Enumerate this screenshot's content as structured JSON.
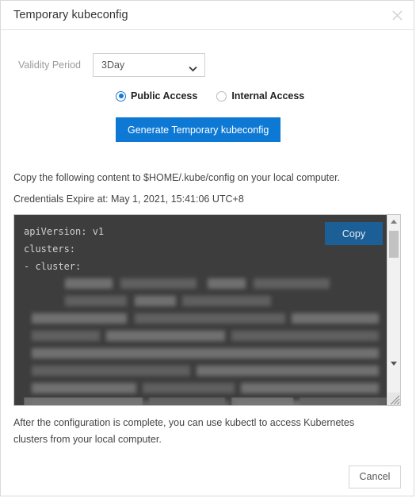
{
  "dialog": {
    "title": "Temporary kubeconfig",
    "close_icon": "close-icon"
  },
  "form": {
    "validity_label": "Validity Period",
    "validity_value": "3Day",
    "validity_options": [
      "3Day"
    ],
    "caret_icon": "chevron-down-icon",
    "access_options": [
      {
        "label": "Public Access",
        "checked": true
      },
      {
        "label": "Internal Access",
        "checked": false
      }
    ],
    "generate_button": "Generate Temporary kubeconfig"
  },
  "info": {
    "copy_hint": "Copy the following content to $HOME/.kube/config on your local computer.",
    "expiry": "Credentials Expire at: May 1, 2021, 15:41:06 UTC+8"
  },
  "code": {
    "copy_button": "Copy",
    "visible_lines": [
      "apiVersion: v1",
      "clusters:",
      "- cluster:"
    ],
    "redacted_line_count": 13,
    "background": "#3d3d3d",
    "text_color": "#cfcfcf",
    "scrollbar": {
      "up_icon": "scroll-up-arrow-icon",
      "down_icon": "scroll-down-arrow-icon",
      "resize_icon": "resize-grip-icon"
    }
  },
  "after_text": "After the configuration is complete, you can use kubectl to access Kubernetes clusters from your local computer.",
  "footer": {
    "cancel_label": "Cancel"
  },
  "colors": {
    "primary": "#0d79d4",
    "copy_button": "#1c5f96",
    "radio_accent": "#1677d2"
  }
}
